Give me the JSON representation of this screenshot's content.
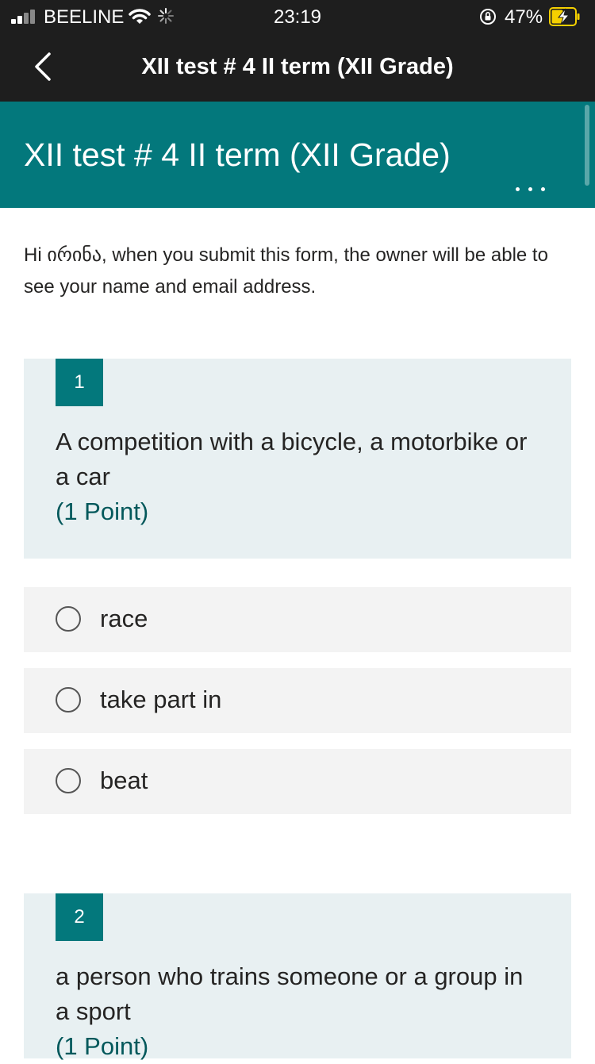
{
  "status_bar": {
    "carrier": "BEELINE",
    "time": "23:19",
    "battery_percent": "47%",
    "battery_color": "#f5d000"
  },
  "nav": {
    "title": "XII test # 4 II term (XII Grade)"
  },
  "form": {
    "title": "XII test # 4 II term (XII Grade)",
    "accent_color": "#03787c",
    "notice": "Hi ირინა, when you submit this form, the owner will be able to see your name and email address."
  },
  "questions": [
    {
      "number": "1",
      "text": "A competition with a bicycle, a motorbike or a car",
      "points": "(1 Point)",
      "options": [
        "race",
        "take part in",
        "beat"
      ]
    },
    {
      "number": "2",
      "text": "a person who trains someone or a group in a sport",
      "points": "(1 Point)"
    }
  ]
}
